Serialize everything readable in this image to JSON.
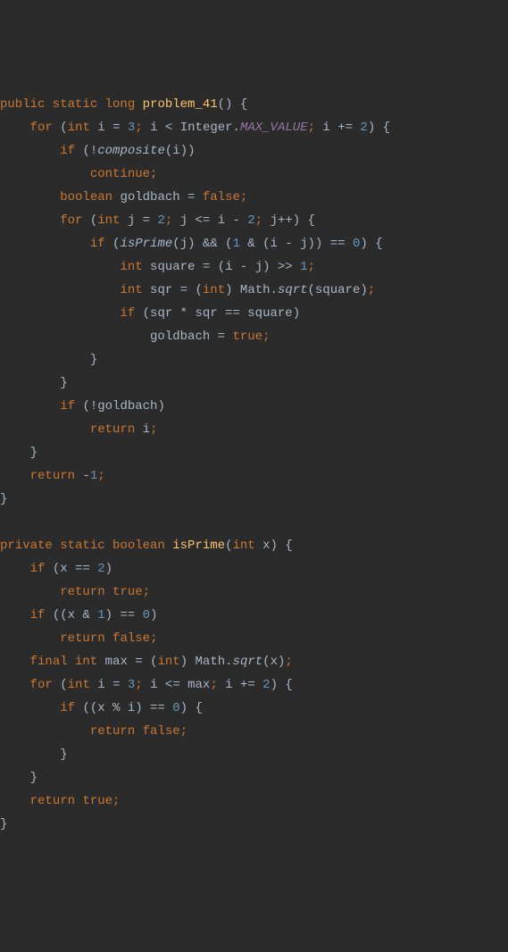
{
  "code": {
    "method1": {
      "modifiers": "public static",
      "return_type": "long",
      "name": "problem_41",
      "params": "",
      "body": {
        "for1": {
          "init_type": "int",
          "init_var": "i",
          "init_val": "3",
          "cond_lhs": "i",
          "cond_op": "<",
          "cond_rhs_obj": "Integer",
          "cond_rhs_field": "MAX_VALUE",
          "iter": "i += ",
          "iter_val": "2",
          "if1_cond_call": "composite",
          "if1_cond_arg": "i",
          "if1_stmt": "continue",
          "decl_type": "boolean",
          "decl_var": "goldbach",
          "decl_val": "false",
          "for2": {
            "init_type": "int",
            "init_var": "j",
            "init_val": "2",
            "cond": "j <= i - ",
            "cond_val": "2",
            "iter": "j++",
            "if_call": "isPrime",
            "if_arg": "j",
            "if_and_lhs": "1",
            "if_and_expr": "i - j",
            "if_eq_val": "0",
            "stmt1_type": "int",
            "stmt1_var": "square",
            "stmt1_expr": "(i - j) >> ",
            "stmt1_val": "1",
            "stmt2_type": "int",
            "stmt2_var": "sqr",
            "stmt2_cast": "int",
            "stmt2_obj": "Math",
            "stmt2_call": "sqrt",
            "stmt2_arg": "square",
            "if3_cond": "sqr * sqr == square",
            "if3_assign_lhs": "goldbach",
            "if3_assign_rhs": "true"
          },
          "if4_cond": "!goldbach",
          "if4_ret": "return",
          "if4_val": "i"
        },
        "ret": "return",
        "ret_val": "-",
        "ret_num": "1"
      }
    },
    "method2": {
      "modifiers": "private static",
      "return_type": "boolean",
      "name": "isPrime",
      "param_type": "int",
      "param_name": "x",
      "if1_cond": "x == ",
      "if1_val": "2",
      "if1_ret": "return",
      "if1_rval": "true",
      "if2_cond_lhs": "x & ",
      "if2_cond_val": "1",
      "if2_eq_val": "0",
      "if2_ret": "return",
      "if2_rval": "false",
      "decl_mod": "final",
      "decl_type": "int",
      "decl_var": "max",
      "decl_cast": "int",
      "decl_obj": "Math",
      "decl_call": "sqrt",
      "decl_arg": "x",
      "for": {
        "init_type": "int",
        "init_var": "i",
        "init_val": "3",
        "cond": "i <= max",
        "iter": "i += ",
        "iter_val": "2",
        "if_cond": "(x % i) == ",
        "if_val": "0",
        "if_ret": "return",
        "if_rval": "false"
      },
      "ret": "return",
      "rval": "true"
    }
  }
}
